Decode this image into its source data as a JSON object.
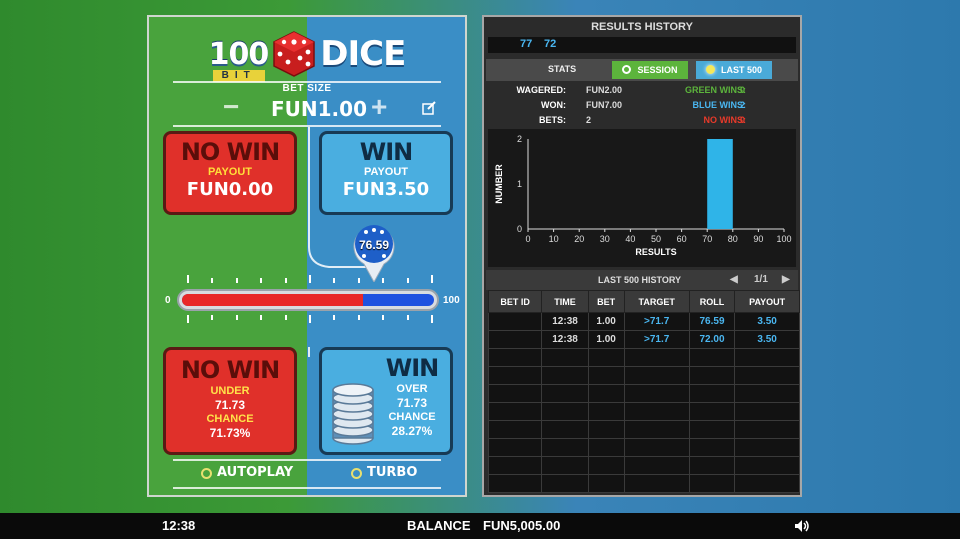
{
  "logo": {
    "number": "100",
    "bit": "BIT",
    "word": "DICE"
  },
  "bet": {
    "label": "BET SIZE",
    "value": "FUN1.00",
    "minus": "−",
    "plus": "+"
  },
  "top_cards": {
    "no_win": {
      "title": "NO WIN",
      "payout_label": "PAYOUT",
      "payout": "FUN0.00"
    },
    "win": {
      "title": "WIN",
      "payout_label": "PAYOUT",
      "payout": "FUN3.50"
    }
  },
  "slider": {
    "min_label": "0",
    "max_label": "100",
    "roll": "76.59",
    "target_fraction": 0.7173
  },
  "bottom_cards": {
    "no_win": {
      "title": "NO WIN",
      "under_label": "UNDER",
      "under": "71.73",
      "chance_label": "CHANCE",
      "chance": "71.73%"
    },
    "win": {
      "title": "WIN",
      "over_label": "OVER",
      "over": "71.73",
      "chance_label": "CHANCE",
      "chance": "28.27%"
    }
  },
  "options": {
    "autoplay": "AUTOPLAY",
    "turbo": "TURBO"
  },
  "results": {
    "title": "RESULTS HISTORY",
    "recent": [
      "77",
      "72"
    ],
    "stats_label": "STATS",
    "tabs": {
      "session": "SESSION",
      "last500": "LAST 500"
    },
    "wagered_label": "WAGERED:",
    "wagered": "FUN2.00",
    "won_label": "WON:",
    "won": "FUN7.00",
    "bets_label": "BETS:",
    "bets": "2",
    "green_wins_label": "GREEN WINS:",
    "green_wins": "0",
    "blue_wins_label": "BLUE WINS:",
    "blue_wins": "2",
    "no_wins_label": "NO WINS:",
    "no_wins": "0",
    "colors": {
      "green": "#5cb43c",
      "blue": "#4ab6f0",
      "red": "#e83a2a"
    }
  },
  "chart_data": {
    "type": "bar",
    "xlabel": "RESULTS",
    "ylabel": "NUMBER",
    "x_ticks": [
      "0",
      "10",
      "20",
      "30",
      "40",
      "50",
      "60",
      "70",
      "80",
      "90",
      "100"
    ],
    "y_ticks": [
      "0",
      "1",
      "2"
    ],
    "xlim": [
      0,
      100
    ],
    "ylim": [
      0,
      2
    ],
    "bars": [
      {
        "x_start": 70,
        "x_end": 80,
        "value": 2
      }
    ],
    "bar_color": "#2fb4e8"
  },
  "history": {
    "title": "LAST 500 HISTORY",
    "page": "1/1",
    "prev": "◀",
    "next": "▶",
    "headers": [
      "BET ID",
      "TIME",
      "BET",
      "TARGET",
      "ROLL",
      "PAYOUT"
    ],
    "rows": [
      [
        "",
        "12:38",
        "1.00",
        ">71.7",
        "76.59",
        "3.50"
      ],
      [
        "",
        "12:38",
        "1.00",
        ">71.7",
        "72.00",
        "3.50"
      ],
      [
        "",
        "",
        "",
        "",
        "",
        ""
      ],
      [
        "",
        "",
        "",
        "",
        "",
        ""
      ],
      [
        "",
        "",
        "",
        "",
        "",
        ""
      ],
      [
        "",
        "",
        "",
        "",
        "",
        ""
      ],
      [
        "",
        "",
        "",
        "",
        "",
        ""
      ],
      [
        "",
        "",
        "",
        "",
        "",
        ""
      ],
      [
        "",
        "",
        "",
        "",
        "",
        ""
      ],
      [
        "",
        "",
        "",
        "",
        "",
        ""
      ]
    ]
  },
  "footer": {
    "time": "12:38",
    "balance_label": "BALANCE",
    "balance": "FUN5,005.00"
  }
}
